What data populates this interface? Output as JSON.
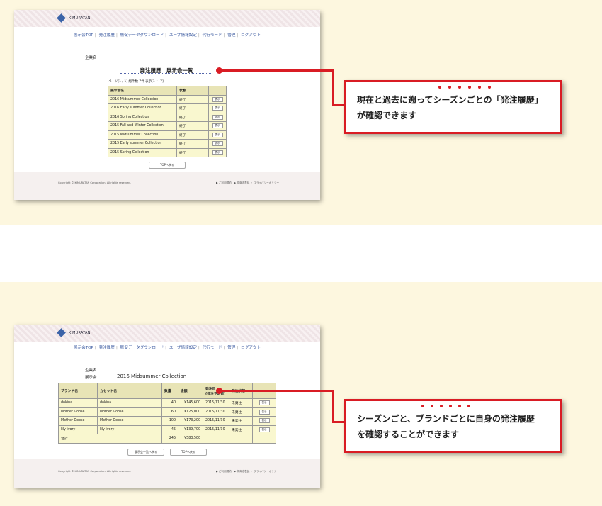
{
  "brand": "KIMURATAN",
  "nav": {
    "items": [
      "展示会TOP",
      "発注履歴",
      "販促データダウンロード",
      "ユーザ情報設定",
      "代行モード",
      "管理",
      "ログアウト"
    ]
  },
  "panel1": {
    "company_label": "企業名",
    "title": "発注履歴　展示会一覧",
    "pagination": "ページ[1 / 1] 総件数 7件 表示[1 ～ 7]",
    "columns": [
      "展示会名",
      "状態",
      ""
    ],
    "rows": [
      {
        "name": "2016 Midsummer Collection",
        "status": "終了",
        "action": "表示"
      },
      {
        "name": "2016 Early summer Collection",
        "status": "終了",
        "action": "表示"
      },
      {
        "name": "2016 Spring Collection",
        "status": "終了",
        "action": "表示"
      },
      {
        "name": "2015 Fall and Winter Collection",
        "status": "終了",
        "action": "表示"
      },
      {
        "name": "2015 Midsummer Collection",
        "status": "終了",
        "action": "表示"
      },
      {
        "name": "2015 Early summer Collection",
        "status": "終了",
        "action": "表示"
      },
      {
        "name": "2015 Spring Collection",
        "status": "終了",
        "action": "表示"
      }
    ],
    "back_button": "TOPへ戻る",
    "copyright": "Copyright © KIMURATAN Corporation. All rights reserved.",
    "footer_links": "▶ ご利用規約　▶ 特商法表記 ・ プライバシーポリシー"
  },
  "panel2": {
    "company_label": "企業名",
    "exhibition_label": "展示会",
    "exhibition_name": "2016 Midsummer Collection",
    "columns": [
      "ブランド名",
      "カセット名",
      "数量",
      "金額",
      "発注日\n(発注予定日)",
      "発注状態",
      ""
    ],
    "rows": [
      {
        "brand": "dokina",
        "cassette": "dokina",
        "qty": "40",
        "amount": "¥145,600",
        "date": "2015/11/30",
        "state": "未発注",
        "action": "表示"
      },
      {
        "brand": "Mother Goose",
        "cassette": "Mother Goose",
        "qty": "60",
        "amount": "¥125,000",
        "date": "2015/11/30",
        "state": "未発注",
        "action": "表示"
      },
      {
        "brand": "Mother Goose",
        "cassette": "Mother Goose",
        "qty": "100",
        "amount": "¥173,200",
        "date": "2015/11/30",
        "state": "未発注",
        "action": "表示"
      },
      {
        "brand": "lily ivory",
        "cassette": "lily ivory",
        "qty": "45",
        "amount": "¥139,700",
        "date": "2015/11/30",
        "state": "未発注",
        "action": "表示"
      }
    ],
    "total": {
      "label": "合計",
      "qty": "245",
      "amount": "¥583,500"
    },
    "back_list_button": "展示会一覧へ戻る",
    "back_top_button": "TOPへ戻る",
    "copyright": "Copyright © KIMURATAN Corporation. All rights reserved.",
    "footer_links": "▶ ご利用規約　▶ 特商法表記 ・ プライバシーポリシー"
  },
  "callout1": {
    "line1": "現在と過去に遡ってシーズンごとの「発注履歴」",
    "line2": "が確認できます"
  },
  "callout2": {
    "line1": "シーズンごと、ブランドごとに自身の発注履歴",
    "line2": "を確認することができます"
  },
  "colors": {
    "accent_red": "#d91c24",
    "band": "#fdf7df",
    "table_bg": "#f9f7cf",
    "link_blue": "#3b5aa0",
    "logo_blue": "#3b63a8"
  }
}
